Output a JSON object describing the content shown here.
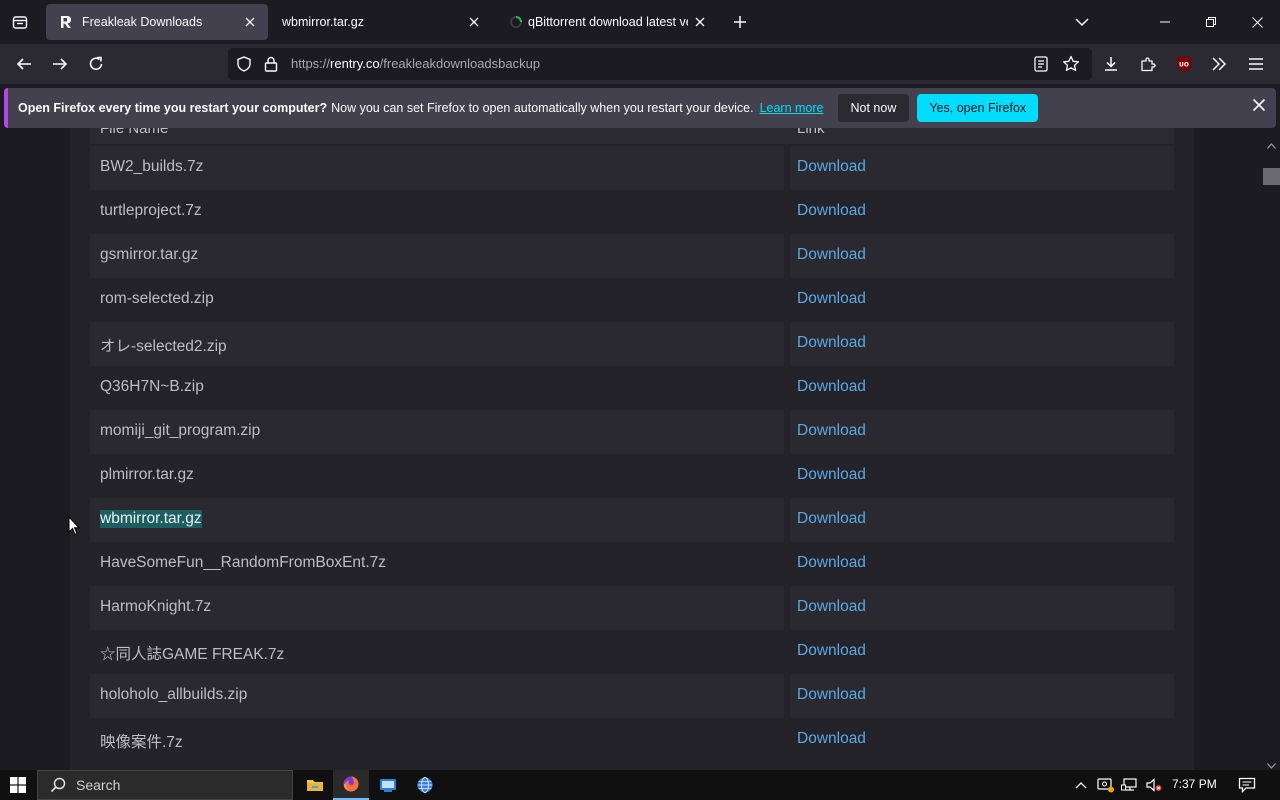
{
  "tabs": [
    {
      "title": "Freakleak Downloads",
      "active": true
    },
    {
      "title": "wbmirror.tar.gz",
      "active": false
    },
    {
      "title": "qBittorrent download latest ver",
      "active": false
    }
  ],
  "url": {
    "scheme": "https://",
    "host": "rentry.co",
    "path": "/freakleakdownloadsbackup"
  },
  "notification": {
    "bold": "Open Firefox every time you restart your computer?",
    "message": "Now you can set Firefox to open automatically when you restart your device.",
    "link": "Learn more",
    "btn_no": "Not now",
    "btn_yes": "Yes, open Firefox"
  },
  "table": {
    "headers": [
      "File Name",
      "Link"
    ],
    "rows": [
      {
        "name": "BW2_builds.7z",
        "link": "Download"
      },
      {
        "name": "turtleproject.7z",
        "link": "Download"
      },
      {
        "name": "gsmirror.tar.gz",
        "link": "Download"
      },
      {
        "name": "rom-selected.zip",
        "link": "Download"
      },
      {
        "name": "オレ-selected2.zip",
        "link": "Download"
      },
      {
        "name": "Q36H7N~B.zip",
        "link": "Download"
      },
      {
        "name": "momiji_git_program.zip",
        "link": "Download"
      },
      {
        "name": "plmirror.tar.gz",
        "link": "Download"
      },
      {
        "name": "wbmirror.tar.gz",
        "link": "Download",
        "selected": true
      },
      {
        "name": "HaveSomeFun__RandomFromBoxEnt.7z",
        "link": "Download"
      },
      {
        "name": "HarmoKnight.7z",
        "link": "Download"
      },
      {
        "name": "☆同人誌GAME FREAK.7z",
        "link": "Download"
      },
      {
        "name": "holoholo_allbuilds.zip",
        "link": "Download"
      },
      {
        "name": "映像案件.7z",
        "link": "Download"
      }
    ]
  },
  "taskbar": {
    "search_label": "Search",
    "time": "7:37 PM"
  },
  "colors": {
    "accent": "#00ddff",
    "link": "#5aa9e6",
    "selection": "#1f5e60"
  }
}
